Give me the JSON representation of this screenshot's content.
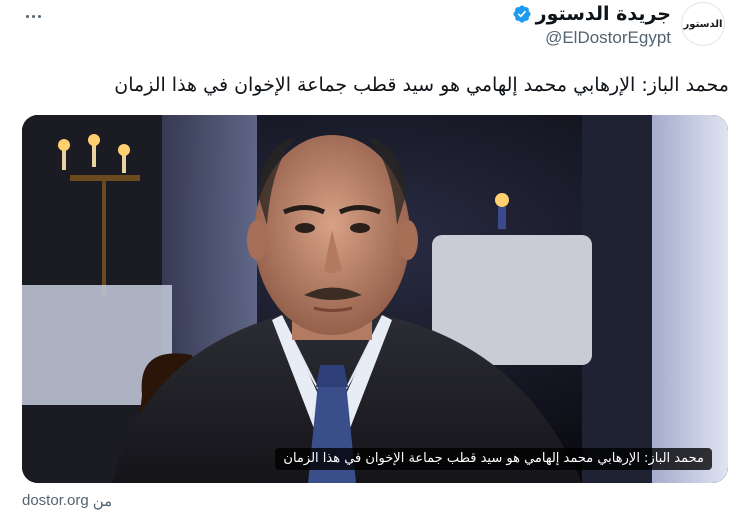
{
  "tweet": {
    "author": {
      "display_name": "جريدة الدستور",
      "handle": "@ElDostorEgypt",
      "avatar_text": "الدستور",
      "verified": true
    },
    "text": "محمد الباز: الإرهابي محمد إلهامي هو سيد قطب جماعة الإخوان في هذا الزمان",
    "card": {
      "image_icon": "portrait-photo",
      "caption": "محمد الباز: الإرهابي محمد إلهامي هو سيد قطب جماعة الإخوان في هذا الزمان",
      "source_prefix": "من",
      "source_domain": "dostor.org"
    },
    "more_icon": "more-dots-icon"
  },
  "colors": {
    "text_primary": "#0f1419",
    "text_secondary": "#536471",
    "verified_blue": "#1d9bf0",
    "caption_bg": "#000000"
  }
}
